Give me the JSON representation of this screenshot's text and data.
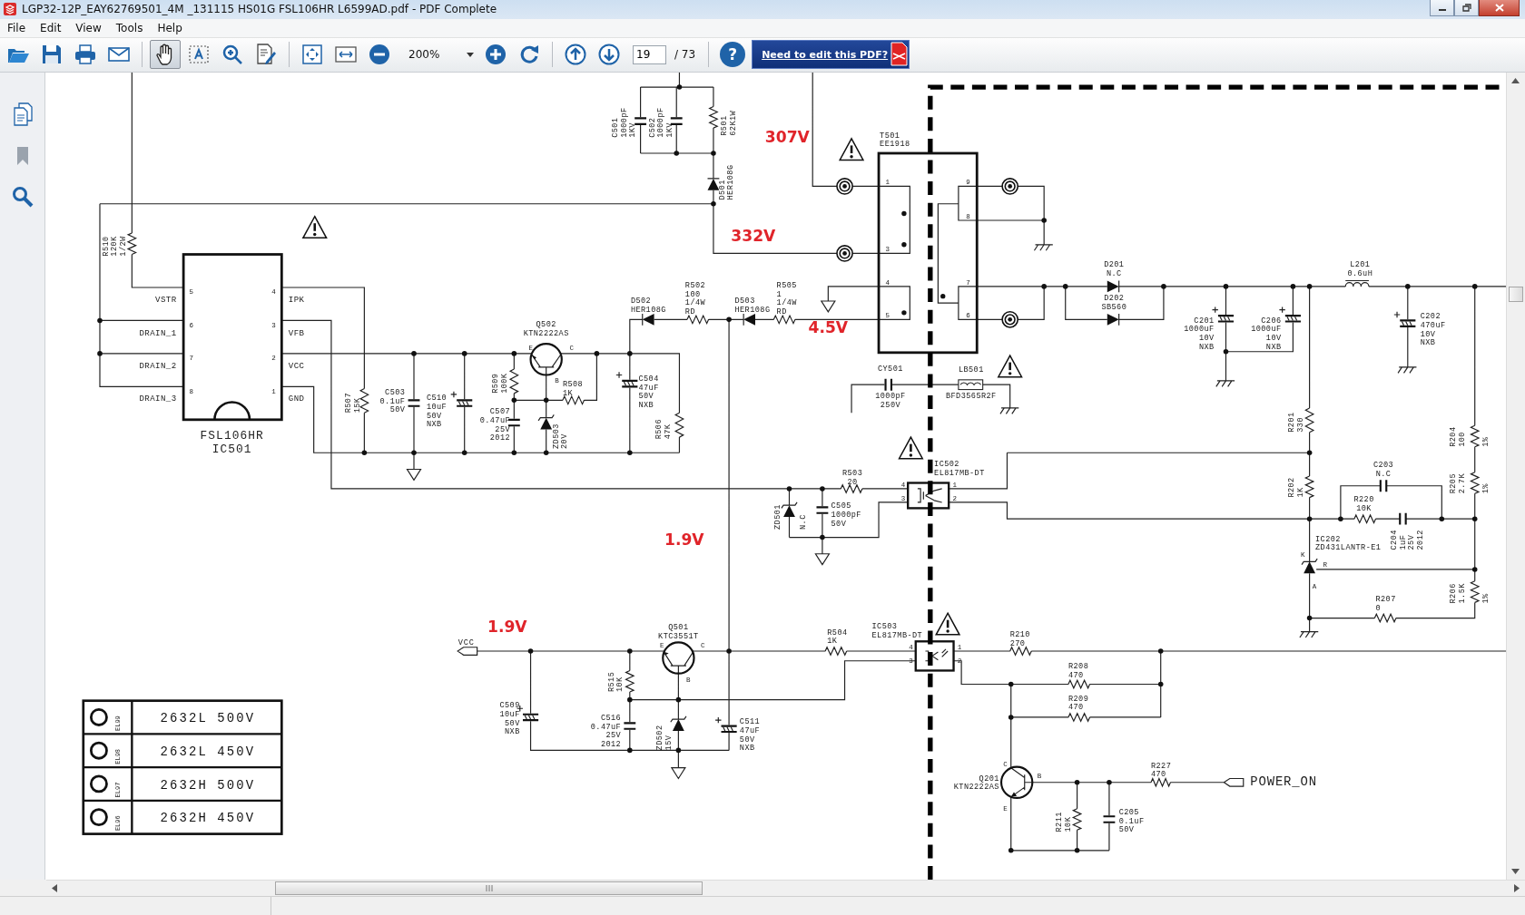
{
  "window": {
    "title": "LGP32-12P_EAY62769501_4M _131115 HS01G FSL106HR L6599AD.pdf - PDF Complete"
  },
  "menu": [
    "File",
    "Edit",
    "View",
    "Tools",
    "Help"
  ],
  "toolbar": [
    [
      {
        "kind": "open",
        "selected": false
      },
      {
        "kind": "save",
        "selected": false
      },
      {
        "kind": "print",
        "selected": false
      },
      {
        "kind": "email",
        "selected": false
      }
    ],
    [
      {
        "kind": "hand",
        "selected": true
      },
      {
        "kind": "text-select",
        "selected": false
      },
      {
        "kind": "zoom-tool",
        "selected": false
      },
      {
        "kind": "annotate",
        "selected": false
      }
    ],
    [
      {
        "kind": "fit-page",
        "selected": false
      },
      {
        "kind": "fit-width",
        "selected": false
      },
      {
        "kind": "zoom-out",
        "selected": false
      },
      {
        "kind": "zoom-field",
        "value": "200%"
      },
      {
        "kind": "zoom-in",
        "selected": false
      },
      {
        "kind": "rotate",
        "selected": false
      }
    ],
    [
      {
        "kind": "prev-page",
        "selected": false
      },
      {
        "kind": "next-page",
        "selected": false
      },
      {
        "kind": "page-field",
        "value": "19",
        "total": "/ 73"
      }
    ],
    [
      {
        "kind": "help",
        "label": "?",
        "selected": false
      },
      {
        "kind": "promo",
        "label": "Need to edit this PDF?"
      }
    ]
  ],
  "schematic": {
    "voltages": [
      "307V",
      "332V",
      "4.5V",
      "1.9V",
      "1.9V"
    ],
    "components": [
      {
        "kind": "part",
        "ref": "C501",
        "values": [
          "1000pF",
          "1KV"
        ]
      },
      {
        "kind": "part",
        "ref": "C502",
        "values": [
          "1000pF",
          "1KV"
        ]
      },
      {
        "kind": "part",
        "ref": "R501",
        "values": [
          "62K1W"
        ]
      },
      {
        "kind": "part",
        "ref": "D501",
        "values": [
          "HER108G"
        ]
      },
      {
        "kind": "part",
        "ref": "R510",
        "values": [
          "120K",
          "1/2W"
        ]
      },
      {
        "kind": "chip",
        "ref": "FSL106HR",
        "values": [
          "IC501"
        ]
      },
      {
        "kind": "part",
        "ref": "Q502",
        "values": [
          "KTN2222AS"
        ]
      },
      {
        "kind": "part",
        "ref": "D502",
        "values": [
          "HER108G"
        ]
      },
      {
        "kind": "part",
        "ref": "R502",
        "values": [
          "100",
          "1/4W",
          "RD"
        ]
      },
      {
        "kind": "part",
        "ref": "D503",
        "values": [
          "HER108G"
        ]
      },
      {
        "kind": "part",
        "ref": "R505",
        "values": [
          "1",
          "1/4W",
          "RD"
        ]
      },
      {
        "kind": "part",
        "ref": "R507",
        "values": [
          "15K"
        ]
      },
      {
        "kind": "part",
        "ref": "C503",
        "values": [
          "0.1uF",
          "50V"
        ]
      },
      {
        "kind": "part",
        "ref": "C510",
        "values": [
          "10uF",
          "50V",
          "NXB"
        ]
      },
      {
        "kind": "part",
        "ref": "R509",
        "values": [
          "100K"
        ]
      },
      {
        "kind": "part",
        "ref": "C507",
        "values": [
          "0.47uF",
          "25V",
          "2012"
        ]
      },
      {
        "kind": "part",
        "ref": "R508",
        "values": [
          "1K"
        ]
      },
      {
        "kind": "part",
        "ref": "ZD503",
        "values": [
          "20V"
        ]
      },
      {
        "kind": "part",
        "ref": "C504",
        "values": [
          "47uF",
          "50V",
          "NXB"
        ]
      },
      {
        "kind": "part",
        "ref": "R506",
        "values": [
          "47K"
        ]
      },
      {
        "kind": "part",
        "ref": "T501",
        "values": [
          "EE1918"
        ]
      },
      {
        "kind": "part",
        "ref": "D201",
        "values": [
          "N.C"
        ]
      },
      {
        "kind": "part",
        "ref": "D202",
        "values": [
          "SB560"
        ]
      },
      {
        "kind": "part",
        "ref": "L201",
        "values": [
          "0.6uH"
        ]
      },
      {
        "kind": "part",
        "ref": "C201",
        "values": [
          "1000uF",
          "10V",
          "NXB"
        ]
      },
      {
        "kind": "part",
        "ref": "C206",
        "values": [
          "1000uF",
          "10V",
          "NXB"
        ]
      },
      {
        "kind": "part",
        "ref": "C202",
        "values": [
          "470uF",
          "10V",
          "NXB"
        ]
      },
      {
        "kind": "part",
        "ref": "CY501",
        "values": [
          "1000pF",
          "250V"
        ]
      },
      {
        "kind": "part",
        "ref": "LB501",
        "values": [
          "BFD3565R2F"
        ]
      },
      {
        "kind": "part",
        "ref": "R201",
        "values": [
          "330"
        ]
      },
      {
        "kind": "part",
        "ref": "R204",
        "values": [
          "100",
          "1%"
        ]
      },
      {
        "kind": "part",
        "ref": "IC502",
        "values": [
          "EL817MB-DT"
        ]
      },
      {
        "kind": "part",
        "ref": "R503",
        "values": [
          "20"
        ]
      },
      {
        "kind": "part",
        "ref": "ZD501",
        "values": [
          "N.C"
        ]
      },
      {
        "kind": "part",
        "ref": "C505",
        "values": [
          "1000pF",
          "50V"
        ]
      },
      {
        "kind": "part",
        "ref": "R202",
        "values": [
          "1K"
        ]
      },
      {
        "kind": "part",
        "ref": "C203",
        "values": [
          "N.C"
        ]
      },
      {
        "kind": "part",
        "ref": "R220",
        "values": [
          "10K"
        ]
      },
      {
        "kind": "part",
        "ref": "C204",
        "values": [
          "1uF",
          "25V",
          "2012"
        ]
      },
      {
        "kind": "part",
        "ref": "R205",
        "values": [
          "2.7K",
          "1%"
        ]
      },
      {
        "kind": "part",
        "ref": "IC202",
        "values": [
          "ZD431LANTR-E1"
        ]
      },
      {
        "kind": "part",
        "ref": "R206",
        "values": [
          "1.5K",
          "1%"
        ]
      },
      {
        "kind": "part",
        "ref": "R207",
        "values": [
          "0"
        ]
      },
      {
        "kind": "part",
        "ref": "Q501",
        "values": [
          "KTC3551T"
        ]
      },
      {
        "kind": "part",
        "ref": "R504",
        "values": [
          "1K"
        ]
      },
      {
        "kind": "part",
        "ref": "IC503",
        "values": [
          "EL817MB-DT"
        ]
      },
      {
        "kind": "part",
        "ref": "R210",
        "values": [
          "270"
        ]
      },
      {
        "kind": "part",
        "ref": "R208",
        "values": [
          "470"
        ]
      },
      {
        "kind": "part",
        "ref": "R209",
        "values": [
          "470"
        ]
      },
      {
        "kind": "part",
        "ref": "R515",
        "values": [
          "10K"
        ]
      },
      {
        "kind": "part",
        "ref": "C509",
        "values": [
          "10uF",
          "50V",
          "NXB"
        ]
      },
      {
        "kind": "part",
        "ref": "C516",
        "values": [
          "0.47uF",
          "25V",
          "2012"
        ]
      },
      {
        "kind": "part",
        "ref": "ZD502",
        "values": [
          "15V"
        ]
      },
      {
        "kind": "part",
        "ref": "C511",
        "values": [
          "47uF",
          "50V",
          "NXB"
        ]
      },
      {
        "kind": "part",
        "ref": "Q201",
        "values": [
          "KTN2222AS"
        ]
      },
      {
        "kind": "part",
        "ref": "R227",
        "values": [
          "470"
        ]
      },
      {
        "kind": "part",
        "ref": "R211",
        "values": [
          "10K"
        ]
      },
      {
        "kind": "part",
        "ref": "C205",
        "values": [
          "0.1uF",
          "50V"
        ]
      }
    ],
    "ic501_pins": [
      {
        "number": "5",
        "name": "VSTR"
      },
      {
        "number": "6",
        "name": "DRAIN_1"
      },
      {
        "number": "7",
        "name": "DRAIN_2"
      },
      {
        "number": "8",
        "name": "DRAIN_3"
      },
      {
        "number": "4",
        "name": "IPK"
      },
      {
        "number": "3",
        "name": "VFB"
      },
      {
        "number": "2",
        "name": "VCC"
      },
      {
        "number": "1",
        "name": "GND"
      }
    ],
    "t501_pins": [
      "1",
      "3",
      "4",
      "5",
      "9",
      "8",
      "7",
      "6"
    ],
    "pin_labels": [
      "E",
      "C",
      "B",
      "4",
      "3",
      "1",
      "2",
      "K",
      "R",
      "A",
      "4",
      "3",
      "1",
      "2",
      "E",
      "C",
      "B",
      "C",
      "B",
      "E"
    ],
    "net_labels": [
      "VCC",
      "POWER_ON"
    ],
    "legend": [
      {
        "code": "EL99",
        "text": "2632L 500V"
      },
      {
        "code": "EL98",
        "text": "2632L 450V"
      },
      {
        "code": "EL97",
        "text": "2632H 500V"
      },
      {
        "code": "EL96",
        "text": "2632H 450V"
      }
    ]
  }
}
